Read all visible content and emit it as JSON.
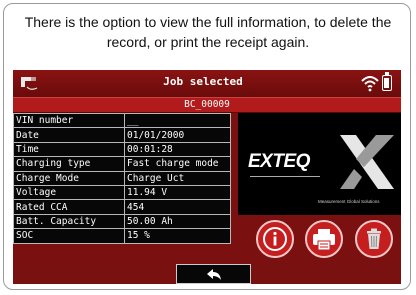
{
  "caption": "There is the option to view the full information, to delete the record, or print the receipt again.",
  "header": {
    "title": "Job selected",
    "job_id": "BC_00009"
  },
  "fields": [
    {
      "label": "VIN number",
      "value": "__"
    },
    {
      "label": "Date",
      "value": "01/01/2000"
    },
    {
      "label": "Time",
      "value": "00:01:28"
    },
    {
      "label": "Charging type",
      "value": "Fast charge mode"
    },
    {
      "label": "Charge Mode",
      "value": "Charge Uct"
    },
    {
      "label": "Voltage",
      "value": "11.94 V"
    },
    {
      "label": "Rated CCA",
      "value": "454"
    },
    {
      "label": "Batt. Capacity",
      "value": "50.00 Ah"
    },
    {
      "label": "SOC",
      "value": "15 %"
    }
  ],
  "logo": {
    "brand": "EXTEQ",
    "tagline": "Measurement Global Solutions"
  },
  "icons": {
    "left": "charger-icon",
    "wifi": "wifi-icon",
    "battery": "battery-icon",
    "info": "info-icon",
    "print": "printer-icon",
    "delete": "trash-icon",
    "back": "back-arrow-icon"
  },
  "colors": {
    "bar": "#7b1010",
    "subbar": "#b11b1b",
    "button": "#c51e1e",
    "table_bg": "#070707"
  }
}
